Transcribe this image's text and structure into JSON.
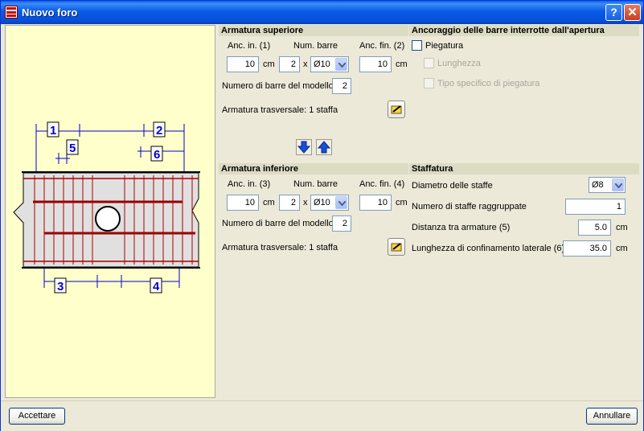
{
  "window": {
    "title": "Nuovo foro"
  },
  "drawing": {
    "dim_labels": [
      "1",
      "2",
      "3",
      "4",
      "5",
      "6"
    ]
  },
  "armatura_superiore": {
    "header": "Armatura superiore",
    "anc_in_label": "Anc. in. (1)",
    "num_barre_label": "Num. barre",
    "anc_fin_label": "Anc. fin. (2)",
    "anc_in_value": "10",
    "anc_in_unit": "cm",
    "num_barre_value": "2",
    "x_label": "x",
    "diametro_value": "Ø10",
    "anc_fin_value": "10",
    "anc_fin_unit": "cm",
    "numero_barre_modello_label": "Numero di barre del modello",
    "numero_barre_modello_value": "2",
    "trasversale_label": "Armatura trasversale: 1 staffa"
  },
  "ancoraggio": {
    "header": "Ancoraggio delle barre interrotte dall'apertura",
    "piegatura_label": "Piegatura",
    "lunghezza_label": "Lunghezza",
    "tipo_label": "Tipo specifico di piegatura"
  },
  "armatura_inferiore": {
    "header": "Armatura inferiore",
    "anc_in_label": "Anc. in. (3)",
    "num_barre_label": "Num. barre",
    "anc_fin_label": "Anc. fin. (4)",
    "anc_in_value": "10",
    "anc_in_unit": "cm",
    "num_barre_value": "2",
    "x_label": "x",
    "diametro_value": "Ø10",
    "anc_fin_value": "10",
    "anc_fin_unit": "cm",
    "numero_barre_modello_label": "Numero di barre del modello",
    "numero_barre_modello_value": "2",
    "trasversale_label": "Armatura trasversale: 1 staffa"
  },
  "staffatura": {
    "header": "Staffatura",
    "diametro_label": "Diametro delle staffe",
    "diametro_value": "Ø8",
    "numero_label": "Numero di staffe raggruppate",
    "numero_value": "1",
    "distanza_label": "Distanza tra armature (5)",
    "distanza_value": "5.0",
    "distanza_unit": "cm",
    "lunghezza_label": "Lunghezza di confinamento laterale (6)",
    "lunghezza_value": "35.0",
    "lunghezza_unit": "cm"
  },
  "buttons": {
    "accept": "Accettare",
    "cancel": "Annullare"
  }
}
